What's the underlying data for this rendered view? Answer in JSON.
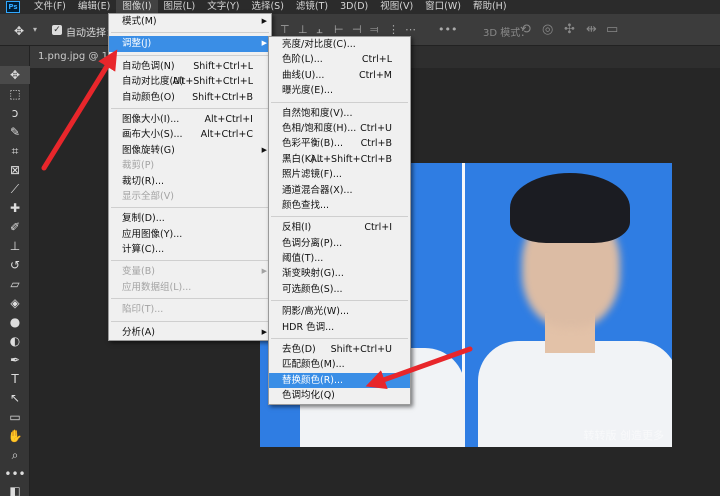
{
  "menubar": {
    "logo": "Ps",
    "items": [
      "文件(F)",
      "编辑(E)",
      "图像(I)",
      "图层(L)",
      "文字(Y)",
      "选择(S)",
      "滤镜(T)",
      "3D(D)",
      "视图(V)",
      "窗口(W)",
      "帮助(H)"
    ]
  },
  "options_bar": {
    "auto_select_label": "自动选择：",
    "mode_3d_label": "3D 模式："
  },
  "document": {
    "tab_label": "1.png.jpg @ 161"
  },
  "photo": {
    "watermark": "转转版  创造更多"
  },
  "image_menu": {
    "items": [
      {
        "label": "模式(M)",
        "shortcut": "",
        "submenu": true,
        "disabled": false,
        "highlight": false,
        "sep_before": false
      },
      {
        "label": "调整(J)",
        "shortcut": "",
        "submenu": true,
        "disabled": false,
        "highlight": true,
        "sep_before": true
      },
      {
        "label": "自动色调(N)",
        "shortcut": "Shift+Ctrl+L",
        "submenu": false,
        "disabled": false,
        "highlight": false,
        "sep_before": true
      },
      {
        "label": "自动对比度(U)",
        "shortcut": "Alt+Shift+Ctrl+L",
        "submenu": false,
        "disabled": false,
        "highlight": false,
        "sep_before": false
      },
      {
        "label": "自动颜色(O)",
        "shortcut": "Shift+Ctrl+B",
        "submenu": false,
        "disabled": false,
        "highlight": false,
        "sep_before": false
      },
      {
        "label": "图像大小(I)...",
        "shortcut": "Alt+Ctrl+I",
        "submenu": false,
        "disabled": false,
        "highlight": false,
        "sep_before": true
      },
      {
        "label": "画布大小(S)...",
        "shortcut": "Alt+Ctrl+C",
        "submenu": false,
        "disabled": false,
        "highlight": false,
        "sep_before": false
      },
      {
        "label": "图像旋转(G)",
        "shortcut": "",
        "submenu": true,
        "disabled": false,
        "highlight": false,
        "sep_before": false
      },
      {
        "label": "裁剪(P)",
        "shortcut": "",
        "submenu": false,
        "disabled": true,
        "highlight": false,
        "sep_before": false
      },
      {
        "label": "裁切(R)...",
        "shortcut": "",
        "submenu": false,
        "disabled": false,
        "highlight": false,
        "sep_before": false
      },
      {
        "label": "显示全部(V)",
        "shortcut": "",
        "submenu": false,
        "disabled": true,
        "highlight": false,
        "sep_before": false
      },
      {
        "label": "复制(D)...",
        "shortcut": "",
        "submenu": false,
        "disabled": false,
        "highlight": false,
        "sep_before": true
      },
      {
        "label": "应用图像(Y)...",
        "shortcut": "",
        "submenu": false,
        "disabled": false,
        "highlight": false,
        "sep_before": false
      },
      {
        "label": "计算(C)...",
        "shortcut": "",
        "submenu": false,
        "disabled": false,
        "highlight": false,
        "sep_before": false
      },
      {
        "label": "变量(B)",
        "shortcut": "",
        "submenu": true,
        "disabled": true,
        "highlight": false,
        "sep_before": true
      },
      {
        "label": "应用数据组(L)...",
        "shortcut": "",
        "submenu": false,
        "disabled": true,
        "highlight": false,
        "sep_before": false
      },
      {
        "label": "陷印(T)...",
        "shortcut": "",
        "submenu": false,
        "disabled": true,
        "highlight": false,
        "sep_before": true
      },
      {
        "label": "分析(A)",
        "shortcut": "",
        "submenu": true,
        "disabled": false,
        "highlight": false,
        "sep_before": true
      }
    ]
  },
  "adjust_menu": {
    "items": [
      {
        "label": "亮度/对比度(C)...",
        "shortcut": "",
        "highlight": false,
        "sep_before": false
      },
      {
        "label": "色阶(L)...",
        "shortcut": "Ctrl+L",
        "highlight": false,
        "sep_before": false
      },
      {
        "label": "曲线(U)...",
        "shortcut": "Ctrl+M",
        "highlight": false,
        "sep_before": false
      },
      {
        "label": "曝光度(E)...",
        "shortcut": "",
        "highlight": false,
        "sep_before": false
      },
      {
        "label": "自然饱和度(V)...",
        "shortcut": "",
        "highlight": false,
        "sep_before": true
      },
      {
        "label": "色相/饱和度(H)...",
        "shortcut": "Ctrl+U",
        "highlight": false,
        "sep_before": false
      },
      {
        "label": "色彩平衡(B)...",
        "shortcut": "Ctrl+B",
        "highlight": false,
        "sep_before": false
      },
      {
        "label": "黑白(K)...",
        "shortcut": "Alt+Shift+Ctrl+B",
        "highlight": false,
        "sep_before": false
      },
      {
        "label": "照片滤镜(F)...",
        "shortcut": "",
        "highlight": false,
        "sep_before": false
      },
      {
        "label": "通道混合器(X)...",
        "shortcut": "",
        "highlight": false,
        "sep_before": false
      },
      {
        "label": "颜色查找...",
        "shortcut": "",
        "highlight": false,
        "sep_before": false
      },
      {
        "label": "反相(I)",
        "shortcut": "Ctrl+I",
        "highlight": false,
        "sep_before": true
      },
      {
        "label": "色调分离(P)...",
        "shortcut": "",
        "highlight": false,
        "sep_before": false
      },
      {
        "label": "阈值(T)...",
        "shortcut": "",
        "highlight": false,
        "sep_before": false
      },
      {
        "label": "渐变映射(G)...",
        "shortcut": "",
        "highlight": false,
        "sep_before": false
      },
      {
        "label": "可选颜色(S)...",
        "shortcut": "",
        "highlight": false,
        "sep_before": false
      },
      {
        "label": "阴影/高光(W)...",
        "shortcut": "",
        "highlight": false,
        "sep_before": true
      },
      {
        "label": "HDR 色调...",
        "shortcut": "",
        "highlight": false,
        "sep_before": false
      },
      {
        "label": "去色(D)",
        "shortcut": "Shift+Ctrl+U",
        "highlight": false,
        "sep_before": true
      },
      {
        "label": "匹配颜色(M)...",
        "shortcut": "",
        "highlight": false,
        "sep_before": false
      },
      {
        "label": "替换颜色(R)...",
        "shortcut": "",
        "highlight": true,
        "sep_before": false
      },
      {
        "label": "色调均化(Q)",
        "shortcut": "",
        "highlight": false,
        "sep_before": false
      }
    ]
  },
  "colors": {
    "highlight": "#3a8ee6",
    "annotation_arrow": "#e8262b",
    "photo_background": "#2f7de3"
  }
}
